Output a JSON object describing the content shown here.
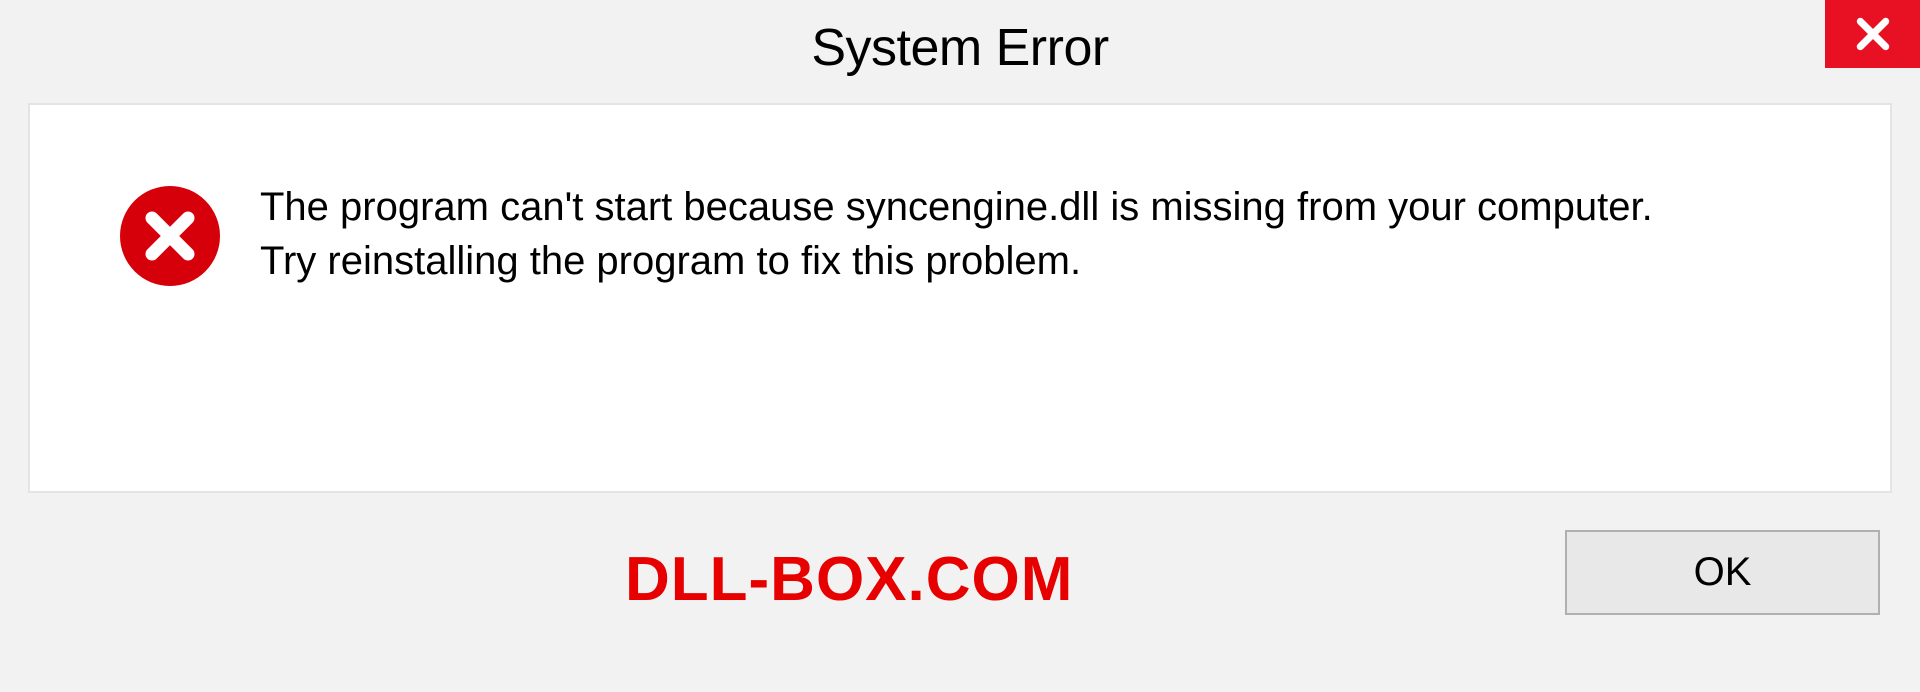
{
  "dialog": {
    "title": "System Error",
    "message": "The program can't start because syncengine.dll is missing from your computer. Try reinstalling the program to fix this problem.",
    "ok_label": "OK"
  },
  "watermark": {
    "text": "DLL-BOX.COM"
  },
  "colors": {
    "close_button_bg": "#e81123",
    "error_icon_bg": "#d6000b",
    "watermark_color": "#e60000"
  }
}
